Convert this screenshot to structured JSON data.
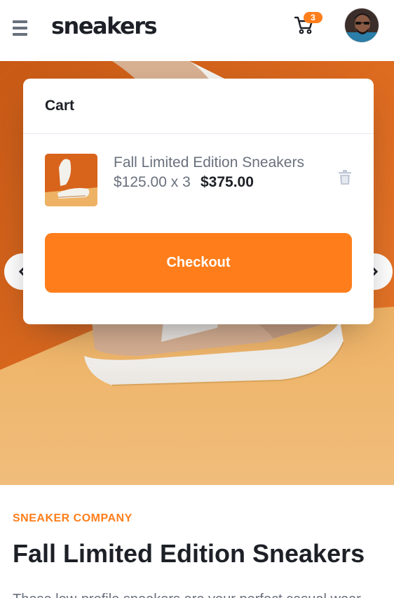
{
  "header": {
    "logo": "sneakers",
    "menu_icon": "hamburger-menu-icon",
    "cart_icon": "shopping-cart-icon",
    "cart_count": "3",
    "avatar_icon": "user-avatar"
  },
  "gallery": {
    "prev_icon": "chevron-left-icon",
    "next_icon": "chevron-right-icon"
  },
  "cart": {
    "title": "Cart",
    "item": {
      "name": "Fall Limited Edition Sneakers",
      "price_qty": "$125.00 x 3",
      "total": "$375.00"
    },
    "delete_icon": "trash-icon",
    "checkout_label": "Checkout"
  },
  "product": {
    "company": "SNEAKER COMPANY",
    "title": "Fall Limited Edition Sneakers",
    "description": "These low-profile sneakers are your perfect casual wear"
  },
  "colors": {
    "accent": "#ff7e1b",
    "dark": "#1d2026",
    "gray": "#69707d"
  }
}
